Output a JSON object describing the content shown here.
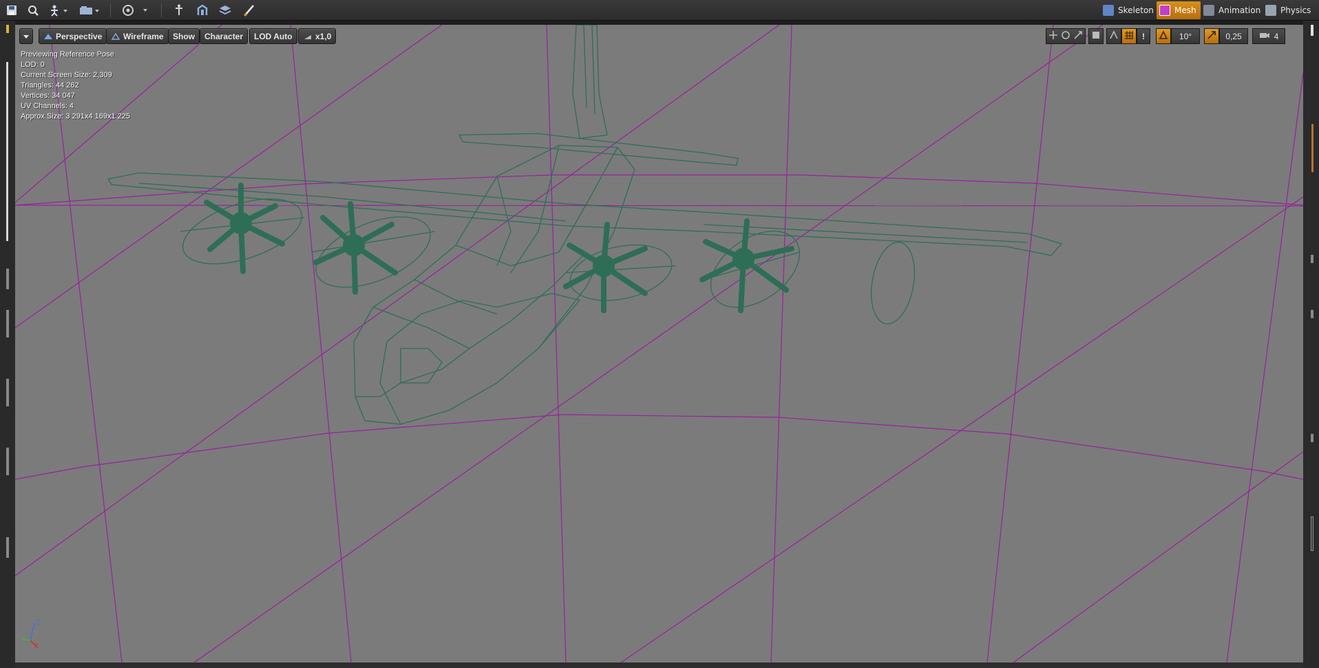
{
  "toolbar": {
    "icons": [
      "save-icon",
      "browse-icon",
      "pose-icon",
      "camera-icon",
      "target-icon",
      "bone-icon",
      "skeleton-icon",
      "layers-icon",
      "brush-icon"
    ],
    "modes": [
      {
        "label": "Skeleton",
        "active": false,
        "icon": "skeleton-mode-icon"
      },
      {
        "label": "Mesh",
        "active": true,
        "icon": "mesh-mode-icon"
      },
      {
        "label": "Animation",
        "active": false,
        "icon": "animation-mode-icon"
      },
      {
        "label": "Physics",
        "active": false,
        "icon": "physics-mode-icon"
      }
    ]
  },
  "viewport": {
    "options_menu": "dropdown-arrow-icon",
    "perspective_label": "Perspective",
    "view_mode_label": "Wireframe",
    "show_label": "Show",
    "character_label": "Character",
    "lod_label": "LOD Auto",
    "playback_label": "x1,0",
    "rotation_snap": "10°",
    "scale_snap": "0,25",
    "camera_speed": "4",
    "colors": {
      "background": "#7b7b7b",
      "grid_lines": "#9a1fa0",
      "wireframe": "#2e6e56",
      "active_accent": "#d8901a"
    }
  },
  "stats": {
    "line1": "Previewing Reference Pose",
    "line2": "LOD: 0",
    "line3": "Current Screen Size: 2,309",
    "line4": "Triangles: 44 262",
    "line5": "Vertices: 34 047",
    "line6": "UV Channels: 4",
    "line7": "Approx Size: 3 291x4 169x1 225"
  },
  "axis_widget": {
    "x": "X",
    "z": "Z"
  }
}
